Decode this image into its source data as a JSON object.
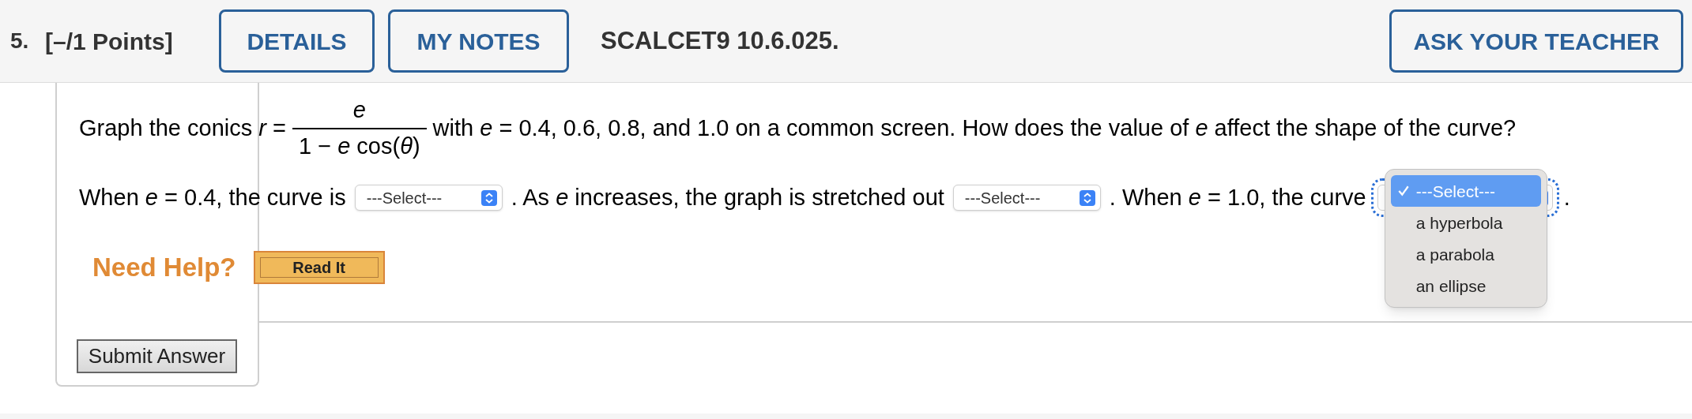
{
  "header": {
    "number": "5.",
    "points": "[–/1 Points]",
    "buttons": [
      {
        "label": "DETAILS"
      },
      {
        "label": "MY NOTES"
      }
    ],
    "code": "SCALCET9 10.6.025.",
    "teacher_button": "ASK YOUR TEACHER"
  },
  "question": {
    "prefix": "Graph the conics *r* =",
    "fraction": {
      "numerator": "e",
      "denominator": "1 − *e* cos(*θ*)"
    },
    "suffix": "with *e* = 0.4, 0.6, 0.8, and 1.0 on a common screen. How does the value of *e* affect the shape of the curve?"
  },
  "answer_line": [
    {
      "kind": "text",
      "text": "When *e* = 0.4, the curve is"
    },
    {
      "kind": "select",
      "value": "---Select---",
      "open": false
    },
    {
      "kind": "text",
      "text": ". As *e* increases, the graph is stretched out"
    },
    {
      "kind": "select",
      "value": "---Select---",
      "open": false
    },
    {
      "kind": "text",
      "text": ". When *e* = 1.0, the curve"
    },
    {
      "kind": "select",
      "open": true,
      "options": [
        {
          "label": "---Select---",
          "selected": true
        },
        {
          "label": "a hyperbola",
          "selected": false
        },
        {
          "label": "a parabola",
          "selected": false
        },
        {
          "label": "an ellipse",
          "selected": false
        }
      ]
    },
    {
      "kind": "text",
      "text": "."
    }
  ],
  "help": {
    "label": "Need Help?",
    "button": "Read It"
  },
  "submit": "Submit Answer"
}
